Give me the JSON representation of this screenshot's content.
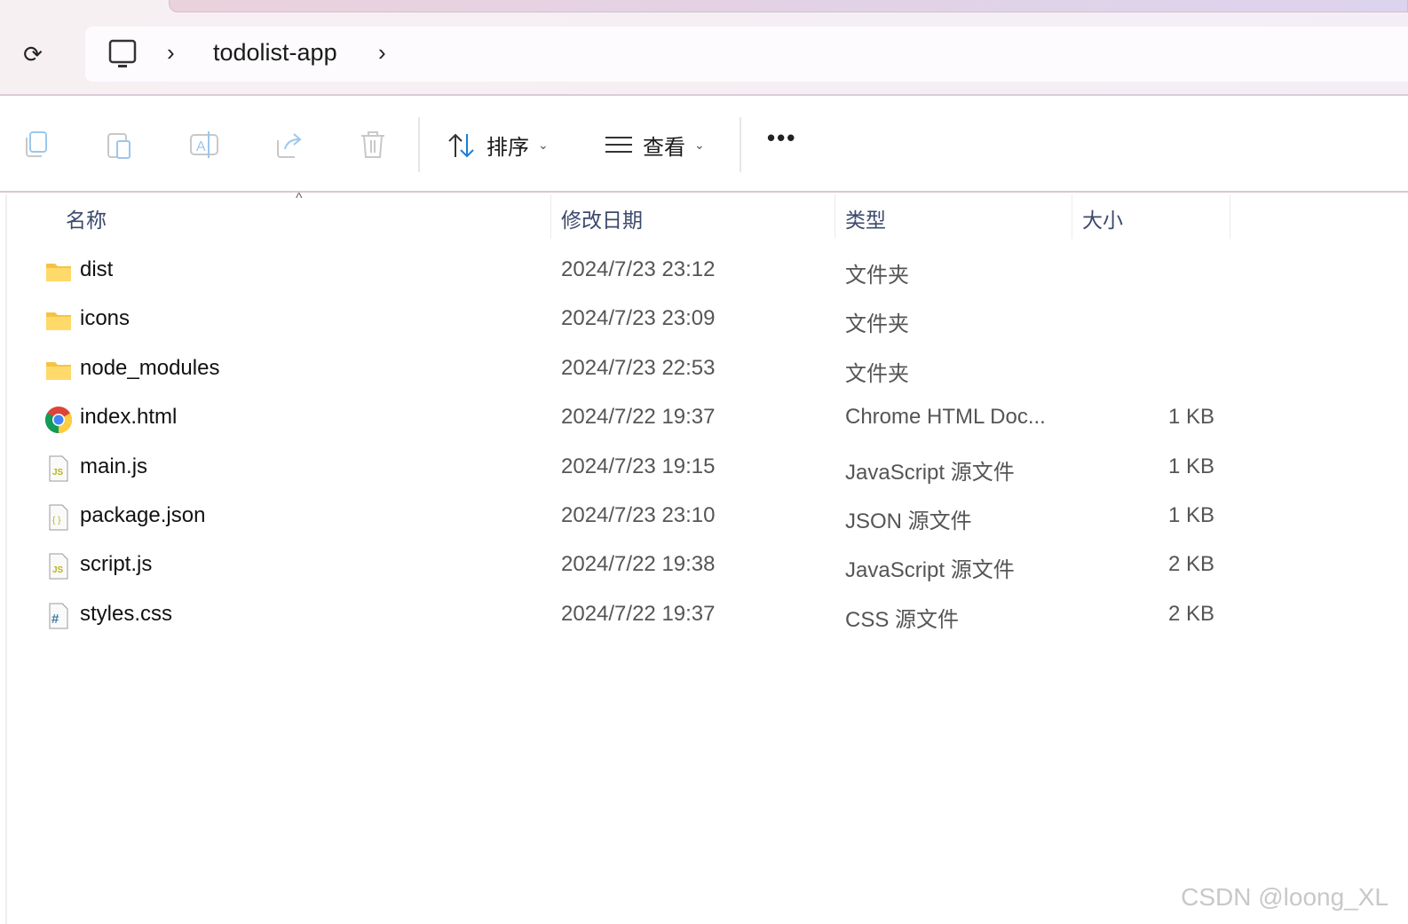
{
  "address": {
    "crumbs": [
      "todolist-app"
    ]
  },
  "toolbar": {
    "sort_label": "排序",
    "view_label": "查看",
    "more_label": "•••"
  },
  "columns": {
    "name": "名称",
    "date": "修改日期",
    "type": "类型",
    "size": "大小"
  },
  "files": [
    {
      "name": "dist",
      "date": "2024/7/23 23:12",
      "type": "文件夹",
      "size": "",
      "icon": "folder-icon"
    },
    {
      "name": "icons",
      "date": "2024/7/23 23:09",
      "type": "文件夹",
      "size": "",
      "icon": "folder-icon"
    },
    {
      "name": "node_modules",
      "date": "2024/7/23 22:53",
      "type": "文件夹",
      "size": "",
      "icon": "folder-icon"
    },
    {
      "name": "index.html",
      "date": "2024/7/22 19:37",
      "type": "Chrome HTML Doc...",
      "size": "1 KB",
      "icon": "chrome-icon"
    },
    {
      "name": "main.js",
      "date": "2024/7/23 19:15",
      "type": "JavaScript 源文件",
      "size": "1 KB",
      "icon": "js-file-icon"
    },
    {
      "name": "package.json",
      "date": "2024/7/23 23:10",
      "type": "JSON 源文件",
      "size": "1 KB",
      "icon": "json-file-icon"
    },
    {
      "name": "script.js",
      "date": "2024/7/22 19:38",
      "type": "JavaScript 源文件",
      "size": "2 KB",
      "icon": "js-file-icon"
    },
    {
      "name": "styles.css",
      "date": "2024/7/22 19:37",
      "type": "CSS 源文件",
      "size": "2 KB",
      "icon": "css-file-icon"
    }
  ],
  "watermark": "CSDN @loong_XL"
}
